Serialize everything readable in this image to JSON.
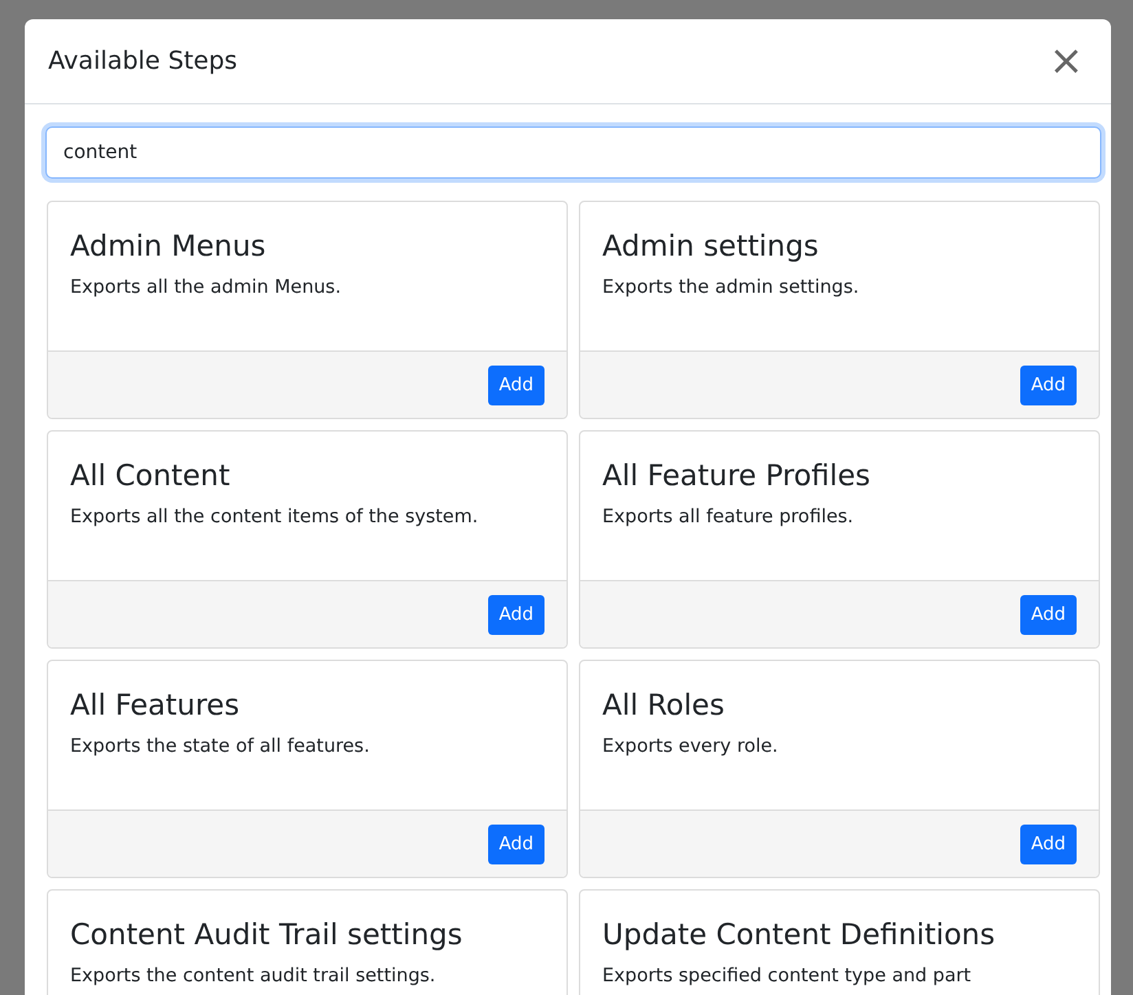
{
  "modal": {
    "title": "Available Steps",
    "close": "×"
  },
  "search": {
    "value": "content"
  },
  "steps": [
    {
      "title": "Admin Menus",
      "description": "Exports all the admin Menus.",
      "button": "Add"
    },
    {
      "title": "Admin settings",
      "description": "Exports the admin settings.",
      "button": "Add"
    },
    {
      "title": "All Content",
      "description": "Exports all the content items of the system.",
      "button": "Add"
    },
    {
      "title": "All Feature Profiles",
      "description": "Exports all feature profiles.",
      "button": "Add"
    },
    {
      "title": "All Features",
      "description": "Exports the state of all features.",
      "button": "Add"
    },
    {
      "title": "All Roles",
      "description": "Exports every role.",
      "button": "Add"
    },
    {
      "title": "Content Audit Trail settings",
      "description": "Exports the content audit trail settings."
    },
    {
      "title": "Update Content Definitions",
      "description": "Exports specified content type and part"
    }
  ]
}
